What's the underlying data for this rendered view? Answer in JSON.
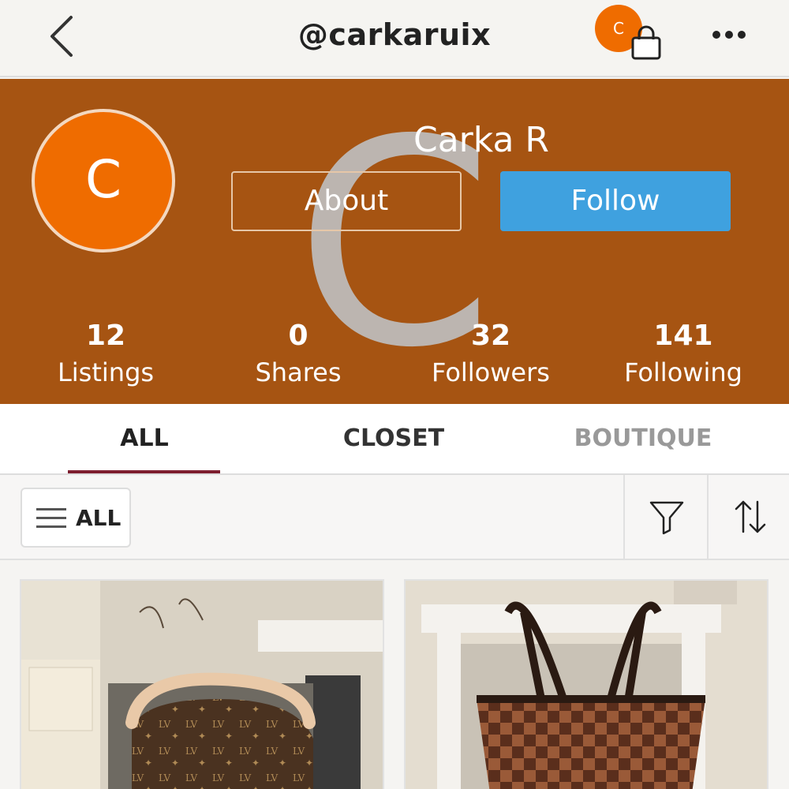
{
  "header": {
    "handle": "@carkaruix",
    "nav_avatar_initial": "C",
    "icons": [
      "back-chevron-icon",
      "shopping-bag-icon",
      "more-dots-icon"
    ]
  },
  "profile": {
    "initial": "C",
    "cover_letter": "C",
    "name": "Carka R",
    "about_label": "About",
    "follow_label": "Follow",
    "banner_color": "#a65412",
    "avatar_color": "#ef6c00",
    "follow_color": "#3fa1df"
  },
  "stats": [
    {
      "value": "12",
      "label": "Listings"
    },
    {
      "value": "0",
      "label": "Shares"
    },
    {
      "value": "32",
      "label": "Followers"
    },
    {
      "value": "141",
      "label": "Following"
    }
  ],
  "tabs": [
    {
      "label": "ALL",
      "active": true
    },
    {
      "label": "CLOSET",
      "active": false
    },
    {
      "label": "BOUTIQUE",
      "active": false
    }
  ],
  "filters": {
    "category_label": "ALL",
    "icons": [
      "hamburger-icon",
      "filter-funnel-icon",
      "sort-arrows-icon"
    ]
  },
  "listings": [
    {
      "pattern": "monogram"
    },
    {
      "pattern": "damier-checker"
    }
  ]
}
